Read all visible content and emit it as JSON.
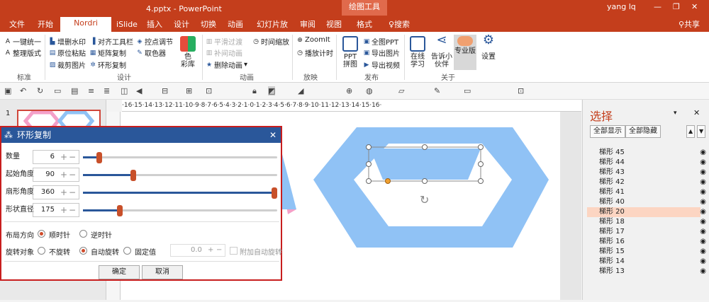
{
  "app": {
    "file_title": "4.pptx - PowerPoint",
    "context_tool": "绘图工具",
    "user": "yang lq",
    "share": "共享"
  },
  "tabs": [
    "文件",
    "开始",
    "Nordri Tools",
    "iSlide",
    "插入",
    "设计",
    "切换",
    "动画",
    "幻灯片放映",
    "审阅",
    "视图",
    "格式",
    "搜索"
  ],
  "ribbon": {
    "standard": {
      "items": [
        "一键统一",
        "整理版式"
      ],
      "label": "标准"
    },
    "design": {
      "items": [
        "增删水印",
        "原位粘贴",
        "裁剪图片",
        "对齐工具栏",
        "矩阵复制",
        "环形复制",
        "控点调节",
        "取色器"
      ],
      "big": "色\n彩库",
      "big_label": "色彩库",
      "label": "设计"
    },
    "animation": {
      "items": [
        "平滑过渡",
        "补间动画",
        "删除动画",
        "时间缩放"
      ],
      "label": "动画"
    },
    "zoom": {
      "items": [
        "ZoomIt",
        "播放计时"
      ],
      "label": "放映"
    },
    "publish": {
      "items": [
        "PPT拼图",
        "全图PPT",
        "导出图片",
        "导出视频"
      ],
      "big_label": "PPT 拼图",
      "label": "发布"
    },
    "about": {
      "items": [
        "在线学习",
        "告诉小伙伴",
        "专业版",
        "设置"
      ],
      "label": "关于"
    }
  },
  "ruler_text": "·16·15·14·13·12·11·10·9·8·7·6·5·4·3·2·1·0·1·2·3·4·5·6·7·8·9·10·11·12·13·14·15·16·",
  "thumb": {
    "slide_number": "1"
  },
  "pane": {
    "title": "选择",
    "show_all": "全部显示",
    "hide_all": "全部隐藏",
    "items": [
      "梯形 45",
      "梯形 44",
      "梯形 43",
      "梯形 42",
      "梯形 41",
      "梯形 40",
      "梯形 20",
      "梯形 18",
      "梯形 17",
      "梯形 16",
      "梯形 15",
      "梯形 14",
      "梯形 13"
    ],
    "selected": "梯形 20"
  },
  "dialog": {
    "title": "环形复制",
    "params": [
      {
        "label": "数量",
        "value": "6",
        "fraction": 0.07
      },
      {
        "label": "起始角度",
        "value": "90",
        "fraction": 0.25
      },
      {
        "label": "扇形角度",
        "value": "360",
        "fraction": 1.0
      },
      {
        "label": "形状直径",
        "value": "175",
        "fraction": 0.18
      }
    ],
    "layout_dir": {
      "label": "布局方向",
      "options": [
        "顺时针",
        "逆时针"
      ],
      "selected": "顺时针"
    },
    "rotate": {
      "label": "旋转对象",
      "options": [
        "不旋转",
        "自动旋转",
        "固定值"
      ],
      "selected": "自动旋转",
      "fixed_value": "0.0",
      "extra": "附加自动旋转"
    },
    "ok": "确定",
    "cancel": "取消"
  },
  "colors": {
    "accent": "#c43e1c",
    "shape_blue": "#90c2f5",
    "dialog_blue": "#2a579a",
    "slider_thumb": "#c8502a",
    "pink": "#f4a0c8"
  }
}
